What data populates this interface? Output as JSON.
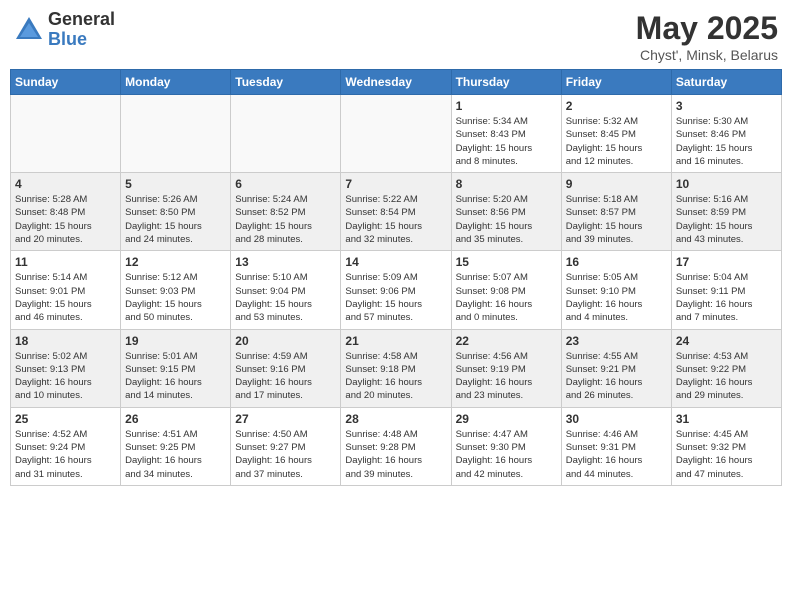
{
  "header": {
    "logo_general": "General",
    "logo_blue": "Blue",
    "title": "May 2025",
    "location": "Chyst', Minsk, Belarus"
  },
  "weekdays": [
    "Sunday",
    "Monday",
    "Tuesday",
    "Wednesday",
    "Thursday",
    "Friday",
    "Saturday"
  ],
  "weeks": [
    [
      {
        "day": "",
        "info": ""
      },
      {
        "day": "",
        "info": ""
      },
      {
        "day": "",
        "info": ""
      },
      {
        "day": "",
        "info": ""
      },
      {
        "day": "1",
        "info": "Sunrise: 5:34 AM\nSunset: 8:43 PM\nDaylight: 15 hours\nand 8 minutes."
      },
      {
        "day": "2",
        "info": "Sunrise: 5:32 AM\nSunset: 8:45 PM\nDaylight: 15 hours\nand 12 minutes."
      },
      {
        "day": "3",
        "info": "Sunrise: 5:30 AM\nSunset: 8:46 PM\nDaylight: 15 hours\nand 16 minutes."
      }
    ],
    [
      {
        "day": "4",
        "info": "Sunrise: 5:28 AM\nSunset: 8:48 PM\nDaylight: 15 hours\nand 20 minutes."
      },
      {
        "day": "5",
        "info": "Sunrise: 5:26 AM\nSunset: 8:50 PM\nDaylight: 15 hours\nand 24 minutes."
      },
      {
        "day": "6",
        "info": "Sunrise: 5:24 AM\nSunset: 8:52 PM\nDaylight: 15 hours\nand 28 minutes."
      },
      {
        "day": "7",
        "info": "Sunrise: 5:22 AM\nSunset: 8:54 PM\nDaylight: 15 hours\nand 32 minutes."
      },
      {
        "day": "8",
        "info": "Sunrise: 5:20 AM\nSunset: 8:56 PM\nDaylight: 15 hours\nand 35 minutes."
      },
      {
        "day": "9",
        "info": "Sunrise: 5:18 AM\nSunset: 8:57 PM\nDaylight: 15 hours\nand 39 minutes."
      },
      {
        "day": "10",
        "info": "Sunrise: 5:16 AM\nSunset: 8:59 PM\nDaylight: 15 hours\nand 43 minutes."
      }
    ],
    [
      {
        "day": "11",
        "info": "Sunrise: 5:14 AM\nSunset: 9:01 PM\nDaylight: 15 hours\nand 46 minutes."
      },
      {
        "day": "12",
        "info": "Sunrise: 5:12 AM\nSunset: 9:03 PM\nDaylight: 15 hours\nand 50 minutes."
      },
      {
        "day": "13",
        "info": "Sunrise: 5:10 AM\nSunset: 9:04 PM\nDaylight: 15 hours\nand 53 minutes."
      },
      {
        "day": "14",
        "info": "Sunrise: 5:09 AM\nSunset: 9:06 PM\nDaylight: 15 hours\nand 57 minutes."
      },
      {
        "day": "15",
        "info": "Sunrise: 5:07 AM\nSunset: 9:08 PM\nDaylight: 16 hours\nand 0 minutes."
      },
      {
        "day": "16",
        "info": "Sunrise: 5:05 AM\nSunset: 9:10 PM\nDaylight: 16 hours\nand 4 minutes."
      },
      {
        "day": "17",
        "info": "Sunrise: 5:04 AM\nSunset: 9:11 PM\nDaylight: 16 hours\nand 7 minutes."
      }
    ],
    [
      {
        "day": "18",
        "info": "Sunrise: 5:02 AM\nSunset: 9:13 PM\nDaylight: 16 hours\nand 10 minutes."
      },
      {
        "day": "19",
        "info": "Sunrise: 5:01 AM\nSunset: 9:15 PM\nDaylight: 16 hours\nand 14 minutes."
      },
      {
        "day": "20",
        "info": "Sunrise: 4:59 AM\nSunset: 9:16 PM\nDaylight: 16 hours\nand 17 minutes."
      },
      {
        "day": "21",
        "info": "Sunrise: 4:58 AM\nSunset: 9:18 PM\nDaylight: 16 hours\nand 20 minutes."
      },
      {
        "day": "22",
        "info": "Sunrise: 4:56 AM\nSunset: 9:19 PM\nDaylight: 16 hours\nand 23 minutes."
      },
      {
        "day": "23",
        "info": "Sunrise: 4:55 AM\nSunset: 9:21 PM\nDaylight: 16 hours\nand 26 minutes."
      },
      {
        "day": "24",
        "info": "Sunrise: 4:53 AM\nSunset: 9:22 PM\nDaylight: 16 hours\nand 29 minutes."
      }
    ],
    [
      {
        "day": "25",
        "info": "Sunrise: 4:52 AM\nSunset: 9:24 PM\nDaylight: 16 hours\nand 31 minutes."
      },
      {
        "day": "26",
        "info": "Sunrise: 4:51 AM\nSunset: 9:25 PM\nDaylight: 16 hours\nand 34 minutes."
      },
      {
        "day": "27",
        "info": "Sunrise: 4:50 AM\nSunset: 9:27 PM\nDaylight: 16 hours\nand 37 minutes."
      },
      {
        "day": "28",
        "info": "Sunrise: 4:48 AM\nSunset: 9:28 PM\nDaylight: 16 hours\nand 39 minutes."
      },
      {
        "day": "29",
        "info": "Sunrise: 4:47 AM\nSunset: 9:30 PM\nDaylight: 16 hours\nand 42 minutes."
      },
      {
        "day": "30",
        "info": "Sunrise: 4:46 AM\nSunset: 9:31 PM\nDaylight: 16 hours\nand 44 minutes."
      },
      {
        "day": "31",
        "info": "Sunrise: 4:45 AM\nSunset: 9:32 PM\nDaylight: 16 hours\nand 47 minutes."
      }
    ]
  ]
}
